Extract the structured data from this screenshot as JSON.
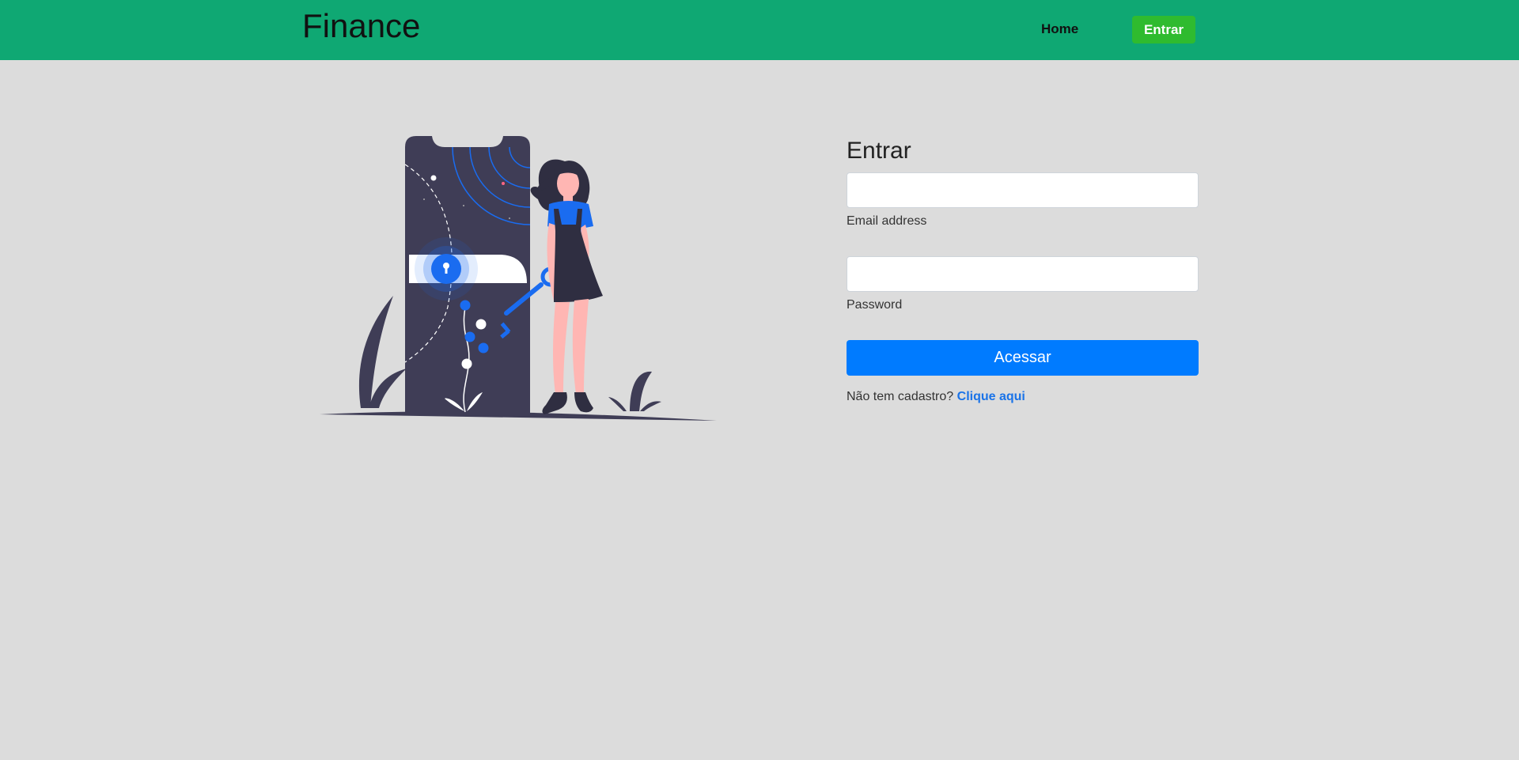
{
  "navbar": {
    "brand": "Finance",
    "home_label": "Home",
    "login_label": "Entrar"
  },
  "form": {
    "title": "Entrar",
    "email": {
      "value": "",
      "label": "Email address"
    },
    "password": {
      "value": "",
      "label": "Password"
    },
    "submit_label": "Acessar",
    "signup_prompt": "Não tem cadastro?",
    "signup_link": "Clique aqui"
  },
  "illustration": {
    "icon": "secure-login-illustration"
  },
  "colors": {
    "navbar": "#0fa873",
    "login_button": "#2fbb2f",
    "primary": "#007bff",
    "background": "#dcdcdc",
    "illustration_dark": "#3f3d56",
    "illustration_accent": "#1a6cf0",
    "skin": "#ffb6b3"
  }
}
